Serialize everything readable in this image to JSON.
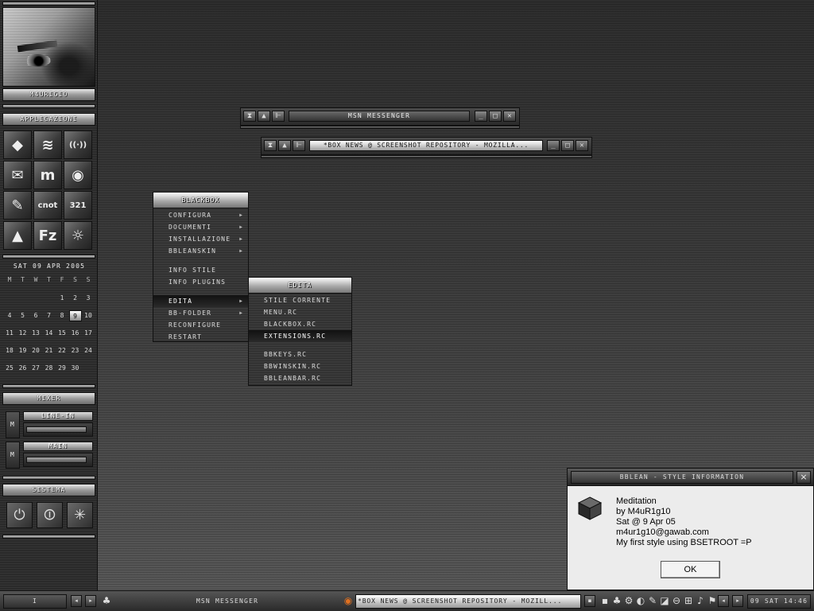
{
  "slit": {
    "user_name": "M4URIGIO",
    "apps_label": "APPLICAZIONI",
    "apps": [
      {
        "icon": "blackbox-icon",
        "glyph": "◆"
      },
      {
        "icon": "winamp-icon",
        "glyph": "≋"
      },
      {
        "icon": "wireless-icon",
        "glyph": "((·))"
      },
      {
        "icon": "thunderbird-icon",
        "glyph": "✉"
      },
      {
        "icon": "msn-messenger-icon",
        "glyph": "m"
      },
      {
        "icon": "firefox-icon",
        "glyph": "◉"
      },
      {
        "icon": "tools-icon",
        "glyph": "✎"
      },
      {
        "icon": "cnot-icon",
        "glyph": "cnot"
      },
      {
        "icon": "clapperboard-icon",
        "glyph": "321"
      },
      {
        "icon": "vlc-icon",
        "glyph": "▲"
      },
      {
        "icon": "filezilla-icon",
        "glyph": "Fz"
      },
      {
        "icon": "photo-icon",
        "glyph": "☼"
      }
    ],
    "calendar": {
      "header": "SAT 09 APR  2005",
      "weekdays": [
        "M",
        "T",
        "W",
        "T",
        "F",
        "S",
        "S"
      ],
      "weeks": [
        [
          "",
          "",
          "",
          "",
          "1",
          "2",
          "3"
        ],
        [
          "4",
          "5",
          "6",
          "7",
          "8",
          "9",
          "10"
        ],
        [
          "11",
          "12",
          "13",
          "14",
          "15",
          "16",
          "17"
        ],
        [
          "18",
          "19",
          "20",
          "21",
          "22",
          "23",
          "24"
        ],
        [
          "25",
          "26",
          "27",
          "28",
          "29",
          "30",
          ""
        ]
      ],
      "today": "9"
    },
    "mixer_label": "MIXER",
    "mixer": [
      {
        "mute": "M",
        "label": "LINE-IN",
        "level": 0.95
      },
      {
        "mute": "M",
        "label": "MAIN",
        "level": 0.95
      }
    ],
    "system_label": "SISTEMA",
    "system_buttons": [
      {
        "icon": "power-icon",
        "glyph": "⏻"
      },
      {
        "icon": "logoff-icon",
        "glyph": "⏼"
      },
      {
        "icon": "restart-icon",
        "glyph": "✳"
      }
    ]
  },
  "windows": {
    "msn": {
      "title": "MSN MESSENGER",
      "buttons": [
        "⧗",
        "▲",
        "⊩"
      ]
    },
    "mozilla": {
      "title": "*BOX NEWS @ SCREENSHOT REPOSITORY - MOZILLA...",
      "buttons": [
        "⧗",
        "▲",
        "⊩"
      ]
    }
  },
  "menu": {
    "title": "BLACKBOX",
    "items": [
      {
        "label": "CONFIGURA",
        "submenu": true
      },
      {
        "label": "DOCUMENTI",
        "submenu": true
      },
      {
        "label": "INSTALLAZIONE",
        "submenu": true
      },
      {
        "label": "BBLEANSKIN",
        "submenu": true
      },
      {
        "label": "INFO STILE",
        "submenu": false
      },
      {
        "label": "INFO PLUGINS",
        "submenu": false
      },
      {
        "label": "EDITA",
        "submenu": true
      },
      {
        "label": "BB-FOLDER",
        "submenu": true
      },
      {
        "label": "RECONFIGURE",
        "submenu": false
      },
      {
        "label": "RESTART",
        "submenu": false
      }
    ]
  },
  "submenu": {
    "title": "EDITA",
    "items": [
      {
        "label": "STILE CORRENTE"
      },
      {
        "label": "MENU.RC"
      },
      {
        "label": "BLACKBOX.RC"
      },
      {
        "label": "EXTENSIONS.RC"
      },
      {
        "label": "BBKEYS.RC"
      },
      {
        "label": "BBWINSKIN.RC"
      },
      {
        "label": "BBLEANBAR.RC"
      }
    ]
  },
  "dialog": {
    "title": "BBLEAN - STYLE INFORMATION",
    "close": "×",
    "lines": [
      "Meditation",
      "by M4uR1g10",
      "Sat @ 9 Apr 05",
      "m4ur1g10@gawab.com",
      "My first style using BSETROOT =P"
    ],
    "ok_label": "OK"
  },
  "taskbar": {
    "workspace": "I",
    "tasks": [
      {
        "label": "MSN MESSENGER",
        "icon": "msn-icon",
        "active": false
      },
      {
        "label": "*BOX NEWS @ SCREENSHOT REPOSITORY - MOZILL...",
        "icon": "firefox-icon",
        "active": true
      }
    ],
    "tray": [
      "▪",
      "♣",
      "⚙",
      "◐",
      "✎",
      "◪",
      "⊖",
      "⊞",
      "♪",
      "⚑"
    ],
    "clock": "09 SAT 14:46"
  }
}
